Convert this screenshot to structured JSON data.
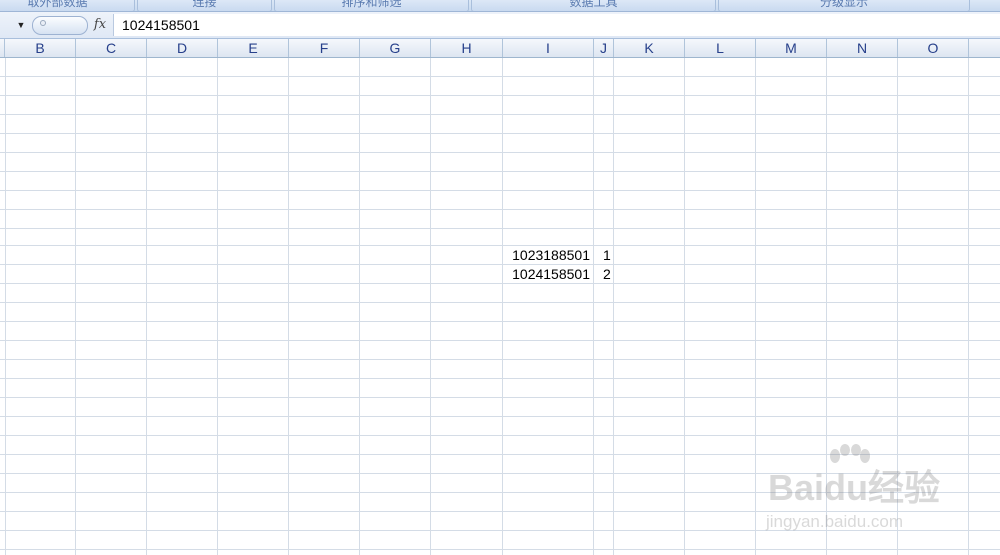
{
  "ribbon": {
    "groups": [
      "取外部数据",
      "连接",
      "排序和筛选",
      "数据工具",
      "分级显示"
    ]
  },
  "formula_bar": {
    "name_box_dropdown_icon": "chevron-down-icon",
    "function_icon_label": "fx",
    "formula_value": "1024158501"
  },
  "columns": [
    "B",
    "C",
    "D",
    "E",
    "F",
    "G",
    "H",
    "I",
    "J",
    "K",
    "L",
    "M",
    "N",
    "O"
  ],
  "cells": {
    "row1": {
      "I": "1023188501",
      "J": "1"
    },
    "row2": {
      "I": "1024158501",
      "J": "2"
    }
  },
  "watermark": {
    "brand": "Baidu经验",
    "url": "jingyan.baidu.com",
    "icon": "paw-icon"
  }
}
